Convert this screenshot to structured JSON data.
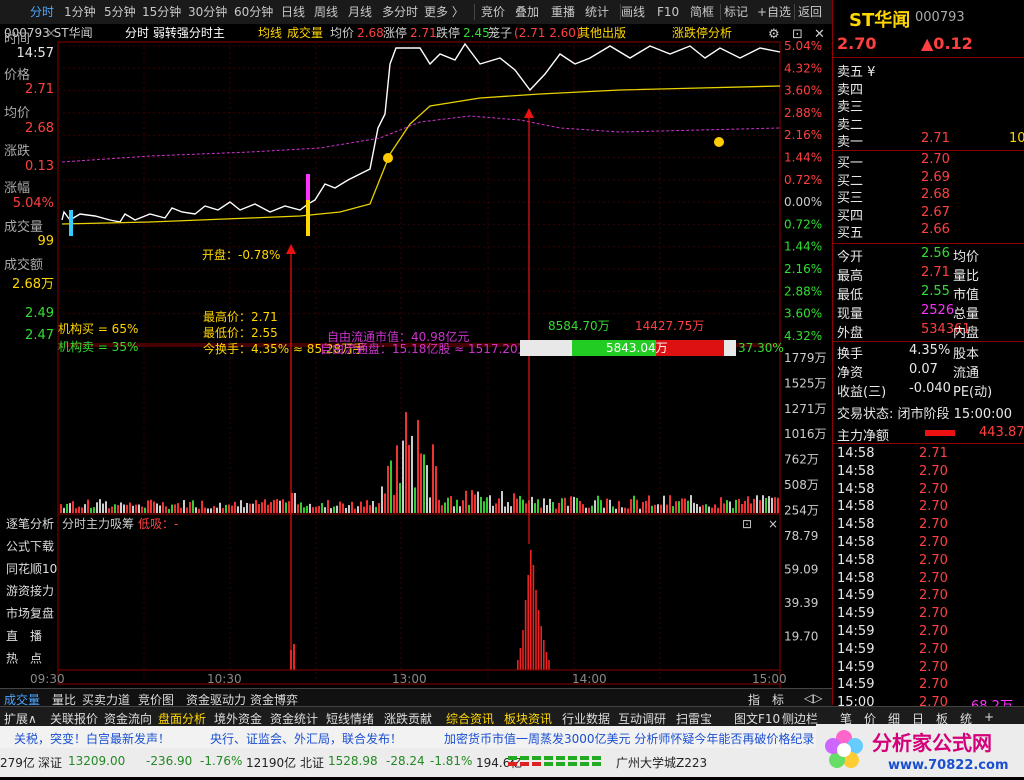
{
  "topbar": {
    "tabs": [
      "分时",
      "1分钟",
      "5分钟",
      "15分钟",
      "30分钟",
      "60分钟",
      "日线",
      "周线",
      "月线",
      "多分时",
      "更多 〉",
      "竞价",
      "叠加",
      "重播",
      "统计",
      "画线",
      "F10",
      "简框",
      "标记",
      "+自选",
      "返回"
    ],
    "active": "分时"
  },
  "header": {
    "code_name": "000793 ST华闻",
    "title": "分时 弱转强分时主",
    "avg_label": "均线",
    "vol_label": "成交量",
    "avg_price_label": "均价",
    "avg_price": "2.68",
    "limit_up_label": "涨停",
    "limit_up": "2.71",
    "limit_down_label": "跌停",
    "limit_down": "2.45",
    "cage_label": "笼子",
    "cage": "(2.71 2.60)",
    "other_label": "其他出版",
    "limit_analysis": "涨跌停分析"
  },
  "left_panel": {
    "time_label": "时间",
    "time": "14:57",
    "price_label": "价格",
    "price": "2.71",
    "avg_label": "均价",
    "avg": "2.68",
    "chg_label": "涨跌",
    "chg": "0.13",
    "pct_label": "涨幅",
    "pct": "5.04%",
    "vol_label": "成交量",
    "vol": "99",
    "amt_label": "成交额",
    "amt": "2.68万",
    "p1": "2.49",
    "p2": "2.47"
  },
  "annotations": {
    "open": "开盘：-0.78%",
    "high": "最高价：2.71",
    "low": "最低价：2.55",
    "turnover": "今换手：4.35% ≈ 85.28万手",
    "float_cap": "自由流通市值：40.98亿元",
    "float_share": "自由流通盘：15.18亿股 ≈ 1517.20万",
    "inst_buy": "机构买 = 65%",
    "inst_sell": "机构卖 = 35%",
    "bar_left": "8584.70万",
    "bar_right": "14427.75万",
    "bar_mid": "5843.04万",
    "bar_pct": "37.30%"
  },
  "price_axis": {
    "right_pct": [
      "5.04%",
      "4.32%",
      "3.60%",
      "2.88%",
      "2.16%",
      "1.44%",
      "0.72%",
      "0.00%",
      "0.72%",
      "1.44%",
      "2.16%",
      "2.88%",
      "3.60%",
      "4.32%"
    ]
  },
  "vol_axis": [
    "1779万",
    "1525万",
    "1271万",
    "1016万",
    "762万",
    "508万",
    "254万"
  ],
  "sub_panel": {
    "title": "分时主力吸筹",
    "low_label": "低吸：-",
    "axis": [
      "78.79",
      "59.09",
      "39.39",
      "19.70"
    ],
    "side_items": [
      "逐笔分析",
      "公式下载",
      "同花顺10",
      "游资接力",
      "市场复盘",
      "直　播",
      "热　点"
    ]
  },
  "time_axis": [
    "09:30",
    "10:30",
    "13:00",
    "14:00",
    "15:00"
  ],
  "bottom_tabs": [
    "成交量",
    "量比",
    "买卖力道",
    "竞价图",
    "资金驱动力",
    "资金博弈",
    "指　标",
    "◁▷"
  ],
  "funcbar": [
    "扩展∧",
    "关联报价",
    "资金流向",
    "盘面分析",
    "境外资金",
    "资金统计",
    "短线情绪",
    "涨跌贡献",
    "综合资讯",
    "板块资讯",
    "行业数据",
    "互动调研",
    "扫雷宝",
    "图文F10",
    "侧边栏"
  ],
  "right": {
    "name": "ST华闻",
    "code": "000793",
    "price": "2.70",
    "change": "▲0.12",
    "sell": [
      {
        "l": "卖五 ¥",
        "p": "",
        "v": ""
      },
      {
        "l": "卖四",
        "p": "",
        "v": ""
      },
      {
        "l": "卖三",
        "p": "",
        "v": ""
      },
      {
        "l": "卖二",
        "p": "",
        "v": ""
      },
      {
        "l": "卖一",
        "p": "2.71",
        "v": "10"
      }
    ],
    "buy": [
      {
        "l": "买一",
        "p": "2.70",
        "v": ""
      },
      {
        "l": "买二",
        "p": "2.69",
        "v": ""
      },
      {
        "l": "买三",
        "p": "2.68",
        "v": ""
      },
      {
        "l": "买四",
        "p": "2.67",
        "v": ""
      },
      {
        "l": "买五",
        "p": "2.66",
        "v": ""
      }
    ],
    "stats": [
      {
        "l": "今开",
        "v": "2.56",
        "l2": "均价",
        "c": "green"
      },
      {
        "l": "最高",
        "v": "2.71",
        "l2": "量比",
        "c": "red"
      },
      {
        "l": "最低",
        "v": "2.55",
        "l2": "市值",
        "c": "green"
      },
      {
        "l": "现量",
        "v": "2526",
        "l2": "总量",
        "c": "mag"
      },
      {
        "l": "外盘",
        "v": "534361",
        "l2": "内盘",
        "c": "red"
      }
    ],
    "stats2": [
      {
        "l": "换手",
        "v": "4.35%",
        "l2": "股本",
        "c": "white"
      },
      {
        "l": "净资",
        "v": "0.07",
        "l2": "流通",
        "c": "white"
      },
      {
        "l": "收益(三)",
        "v": "-0.040",
        "l2": "PE(动)",
        "c": "white"
      }
    ],
    "trade_state": "交易状态: 闭市阶段 15:00:00",
    "main_net_label": "主力净额",
    "main_net": "443.87",
    "ticks": [
      {
        "t": "14:58",
        "p": "2.71",
        "v": ""
      },
      {
        "t": "14:58",
        "p": "2.70",
        "v": ""
      },
      {
        "t": "14:58",
        "p": "2.70",
        "v": ""
      },
      {
        "t": "14:58",
        "p": "2.70",
        "v": ""
      },
      {
        "t": "14:58",
        "p": "2.70",
        "v": ""
      },
      {
        "t": "14:58",
        "p": "2.70",
        "v": ""
      },
      {
        "t": "14:58",
        "p": "2.70",
        "v": ""
      },
      {
        "t": "14:58",
        "p": "2.70",
        "v": ""
      },
      {
        "t": "14:59",
        "p": "2.70",
        "v": ""
      },
      {
        "t": "14:59",
        "p": "2.70",
        "v": ""
      },
      {
        "t": "14:59",
        "p": "2.70",
        "v": ""
      },
      {
        "t": "14:59",
        "p": "2.70",
        "v": ""
      },
      {
        "t": "14:59",
        "p": "2.70",
        "v": ""
      },
      {
        "t": "14:59",
        "p": "2.70",
        "v": ""
      },
      {
        "t": "15:00",
        "p": "2.70",
        "v": "68.2万"
      }
    ],
    "bottom_tabs": [
      "笔",
      "价",
      "细",
      "日",
      "板",
      "统",
      "+"
    ]
  },
  "news": [
    "关税，突变！白宫最新发声！",
    "央行、证监会、外汇局，联合发布！",
    "加密货币市值一周蒸发3000亿美元 分析师怀疑今年能否再破价格纪录"
  ],
  "status": {
    "idx1_val": "279亿",
    "sz_label": "深证",
    "sz": "13209.00",
    "sz_chg": "-236.90",
    "sz_pct": "-1.76%",
    "sz_amt": "12190亿",
    "bz_label": "北证",
    "bz": "1528.98",
    "bz_chg": "-28.24",
    "bz_pct": "-1.81%",
    "bz_amt": "194.6亿",
    "place": "广州大学城Z223"
  },
  "logo": {
    "text": "分析家公式网",
    "url": "www.70822.com"
  }
}
